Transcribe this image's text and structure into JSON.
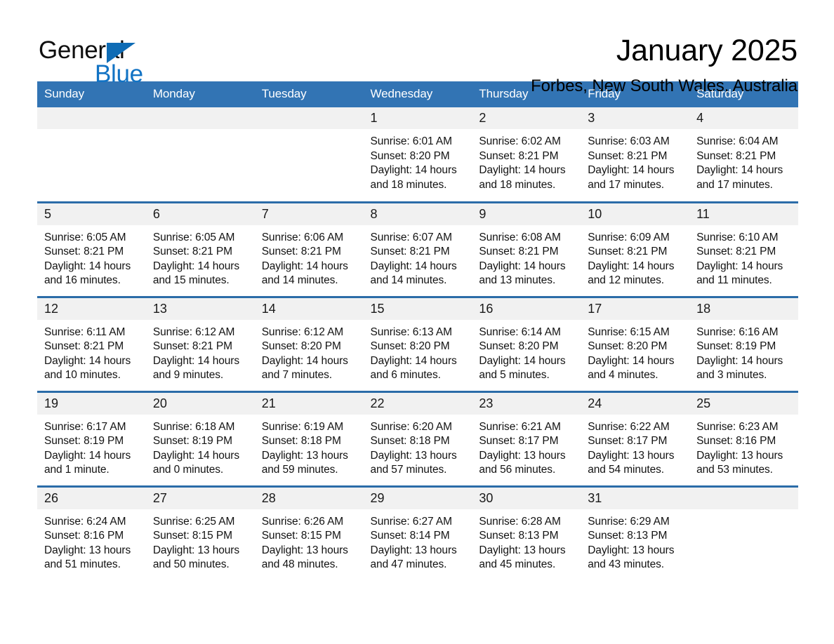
{
  "brand": {
    "name_part1": "General",
    "name_part2": "Blue",
    "triangle_color": "#0f6cb5",
    "blue_color": "#1273c4"
  },
  "header": {
    "title": "January 2025",
    "location": "Forbes, New South Wales, Australia"
  },
  "theme": {
    "header_blue": "#3274b4",
    "row_rule_blue": "#2b6ca8",
    "daynum_band": "#f1f1f1"
  },
  "weekdays": [
    "Sunday",
    "Monday",
    "Tuesday",
    "Wednesday",
    "Thursday",
    "Friday",
    "Saturday"
  ],
  "labels": {
    "sunrise": "Sunrise:",
    "sunset": "Sunset:",
    "daylight": "Daylight:"
  },
  "weeks": [
    [
      {
        "day": "",
        "lines": []
      },
      {
        "day": "",
        "lines": []
      },
      {
        "day": "",
        "lines": []
      },
      {
        "day": "1",
        "lines": [
          "Sunrise: 6:01 AM",
          "Sunset: 8:20 PM",
          "Daylight: 14 hours",
          "and 18 minutes."
        ]
      },
      {
        "day": "2",
        "lines": [
          "Sunrise: 6:02 AM",
          "Sunset: 8:21 PM",
          "Daylight: 14 hours",
          "and 18 minutes."
        ]
      },
      {
        "day": "3",
        "lines": [
          "Sunrise: 6:03 AM",
          "Sunset: 8:21 PM",
          "Daylight: 14 hours",
          "and 17 minutes."
        ]
      },
      {
        "day": "4",
        "lines": [
          "Sunrise: 6:04 AM",
          "Sunset: 8:21 PM",
          "Daylight: 14 hours",
          "and 17 minutes."
        ]
      }
    ],
    [
      {
        "day": "5",
        "lines": [
          "Sunrise: 6:05 AM",
          "Sunset: 8:21 PM",
          "Daylight: 14 hours",
          "and 16 minutes."
        ]
      },
      {
        "day": "6",
        "lines": [
          "Sunrise: 6:05 AM",
          "Sunset: 8:21 PM",
          "Daylight: 14 hours",
          "and 15 minutes."
        ]
      },
      {
        "day": "7",
        "lines": [
          "Sunrise: 6:06 AM",
          "Sunset: 8:21 PM",
          "Daylight: 14 hours",
          "and 14 minutes."
        ]
      },
      {
        "day": "8",
        "lines": [
          "Sunrise: 6:07 AM",
          "Sunset: 8:21 PM",
          "Daylight: 14 hours",
          "and 14 minutes."
        ]
      },
      {
        "day": "9",
        "lines": [
          "Sunrise: 6:08 AM",
          "Sunset: 8:21 PM",
          "Daylight: 14 hours",
          "and 13 minutes."
        ]
      },
      {
        "day": "10",
        "lines": [
          "Sunrise: 6:09 AM",
          "Sunset: 8:21 PM",
          "Daylight: 14 hours",
          "and 12 minutes."
        ]
      },
      {
        "day": "11",
        "lines": [
          "Sunrise: 6:10 AM",
          "Sunset: 8:21 PM",
          "Daylight: 14 hours",
          "and 11 minutes."
        ]
      }
    ],
    [
      {
        "day": "12",
        "lines": [
          "Sunrise: 6:11 AM",
          "Sunset: 8:21 PM",
          "Daylight: 14 hours",
          "and 10 minutes."
        ]
      },
      {
        "day": "13",
        "lines": [
          "Sunrise: 6:12 AM",
          "Sunset: 8:21 PM",
          "Daylight: 14 hours",
          "and 9 minutes."
        ]
      },
      {
        "day": "14",
        "lines": [
          "Sunrise: 6:12 AM",
          "Sunset: 8:20 PM",
          "Daylight: 14 hours",
          "and 7 minutes."
        ]
      },
      {
        "day": "15",
        "lines": [
          "Sunrise: 6:13 AM",
          "Sunset: 8:20 PM",
          "Daylight: 14 hours",
          "and 6 minutes."
        ]
      },
      {
        "day": "16",
        "lines": [
          "Sunrise: 6:14 AM",
          "Sunset: 8:20 PM",
          "Daylight: 14 hours",
          "and 5 minutes."
        ]
      },
      {
        "day": "17",
        "lines": [
          "Sunrise: 6:15 AM",
          "Sunset: 8:20 PM",
          "Daylight: 14 hours",
          "and 4 minutes."
        ]
      },
      {
        "day": "18",
        "lines": [
          "Sunrise: 6:16 AM",
          "Sunset: 8:19 PM",
          "Daylight: 14 hours",
          "and 3 minutes."
        ]
      }
    ],
    [
      {
        "day": "19",
        "lines": [
          "Sunrise: 6:17 AM",
          "Sunset: 8:19 PM",
          "Daylight: 14 hours",
          "and 1 minute."
        ]
      },
      {
        "day": "20",
        "lines": [
          "Sunrise: 6:18 AM",
          "Sunset: 8:19 PM",
          "Daylight: 14 hours",
          "and 0 minutes."
        ]
      },
      {
        "day": "21",
        "lines": [
          "Sunrise: 6:19 AM",
          "Sunset: 8:18 PM",
          "Daylight: 13 hours",
          "and 59 minutes."
        ]
      },
      {
        "day": "22",
        "lines": [
          "Sunrise: 6:20 AM",
          "Sunset: 8:18 PM",
          "Daylight: 13 hours",
          "and 57 minutes."
        ]
      },
      {
        "day": "23",
        "lines": [
          "Sunrise: 6:21 AM",
          "Sunset: 8:17 PM",
          "Daylight: 13 hours",
          "and 56 minutes."
        ]
      },
      {
        "day": "24",
        "lines": [
          "Sunrise: 6:22 AM",
          "Sunset: 8:17 PM",
          "Daylight: 13 hours",
          "and 54 minutes."
        ]
      },
      {
        "day": "25",
        "lines": [
          "Sunrise: 6:23 AM",
          "Sunset: 8:16 PM",
          "Daylight: 13 hours",
          "and 53 minutes."
        ]
      }
    ],
    [
      {
        "day": "26",
        "lines": [
          "Sunrise: 6:24 AM",
          "Sunset: 8:16 PM",
          "Daylight: 13 hours",
          "and 51 minutes."
        ]
      },
      {
        "day": "27",
        "lines": [
          "Sunrise: 6:25 AM",
          "Sunset: 8:15 PM",
          "Daylight: 13 hours",
          "and 50 minutes."
        ]
      },
      {
        "day": "28",
        "lines": [
          "Sunrise: 6:26 AM",
          "Sunset: 8:15 PM",
          "Daylight: 13 hours",
          "and 48 minutes."
        ]
      },
      {
        "day": "29",
        "lines": [
          "Sunrise: 6:27 AM",
          "Sunset: 8:14 PM",
          "Daylight: 13 hours",
          "and 47 minutes."
        ]
      },
      {
        "day": "30",
        "lines": [
          "Sunrise: 6:28 AM",
          "Sunset: 8:13 PM",
          "Daylight: 13 hours",
          "and 45 minutes."
        ]
      },
      {
        "day": "31",
        "lines": [
          "Sunrise: 6:29 AM",
          "Sunset: 8:13 PM",
          "Daylight: 13 hours",
          "and 43 minutes."
        ]
      },
      {
        "day": "",
        "lines": []
      }
    ]
  ]
}
